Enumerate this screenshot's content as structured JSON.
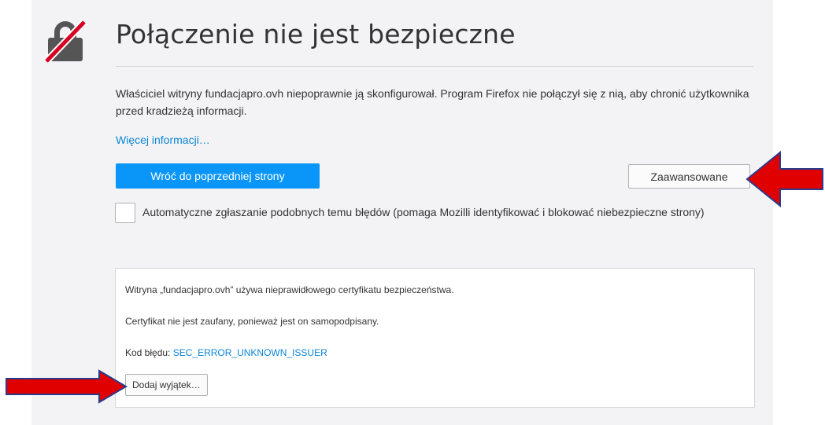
{
  "page": {
    "title": "Połączenie nie jest bezpieczne",
    "description": "Właściciel witryny fundacjapro.ovh niepoprawnie ją skonfigurował. Program Firefox nie połączył się z nią, aby chronić użytkownika przed kradzieżą informacji.",
    "more_info_link": "Więcej informacji…"
  },
  "buttons": {
    "go_back": "Wróć do poprzedniej strony",
    "advanced": "Zaawansowane"
  },
  "report_checkbox": {
    "label": "Automatyczne zgłaszanie podobnych temu błędów (pomaga Mozilli identyfikować i blokować niebezpieczne strony)",
    "checked": false
  },
  "details": {
    "invalid_cert": "Witryna „fundacjapro.ovh” używa nieprawidłowego certyfikatu bezpieczeństwa.",
    "untrusted": "Certyfikat nie jest zaufany, ponieważ jest on samopodpisany.",
    "error_code_label": "Kod błędu: ",
    "error_code": "SEC_ERROR_UNKNOWN_ISSUER",
    "add_exception": "Dodaj wyjątek…"
  },
  "icons": {
    "lock": "broken-lock-icon",
    "arrow_advanced": "red-arrow-left-icon",
    "arrow_exception": "red-arrow-right-icon"
  },
  "colors": {
    "accent": "#0996f8",
    "link": "#0a84d6",
    "annotation_arrow": "#e00000",
    "arrow_outline": "#2a3a8c"
  }
}
